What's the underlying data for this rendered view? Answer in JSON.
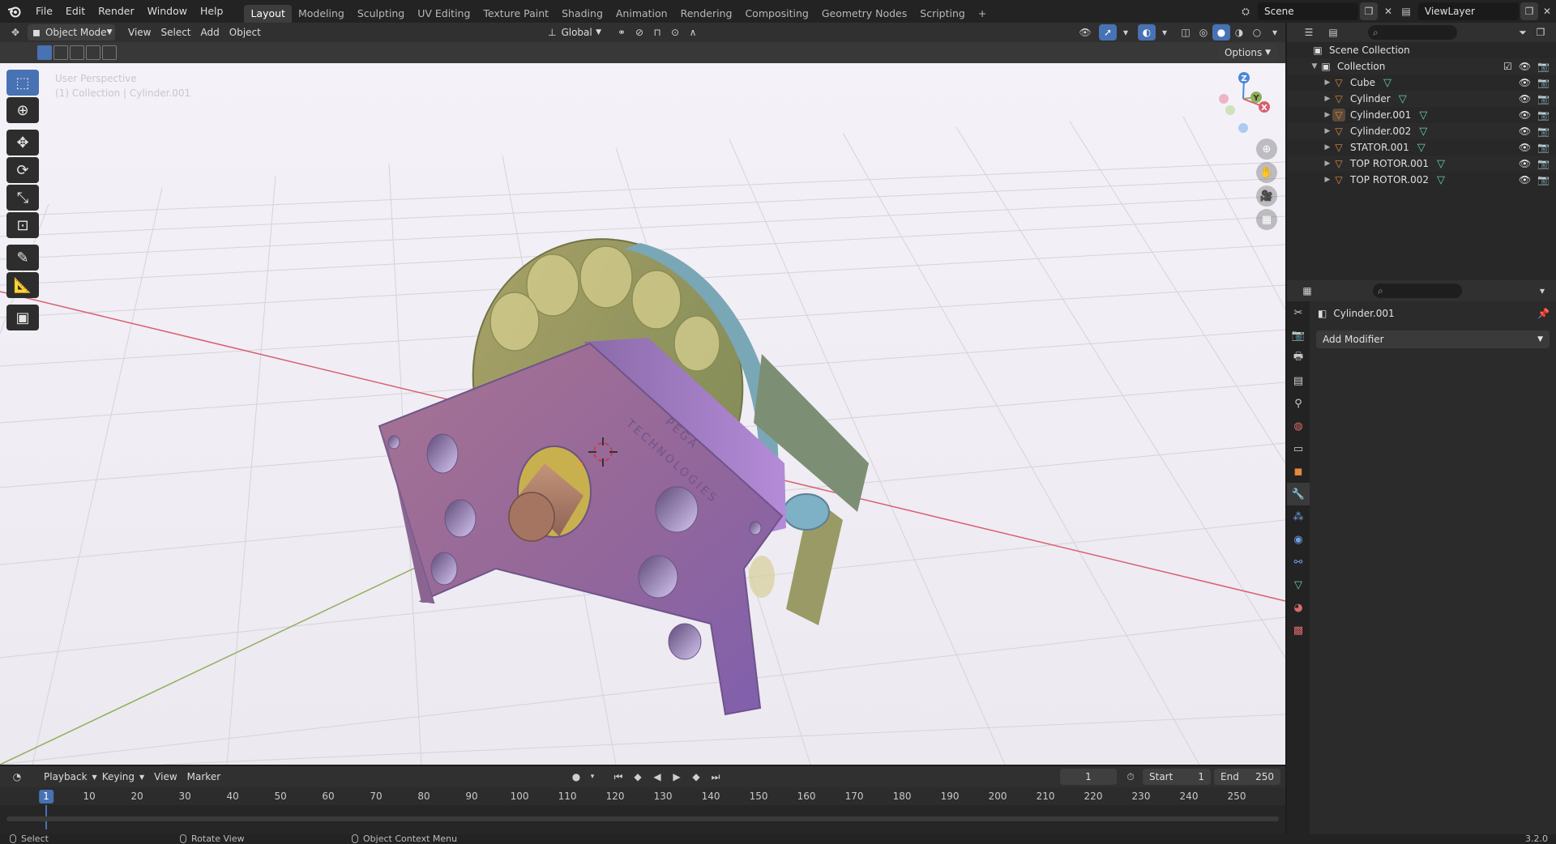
{
  "menus": [
    "File",
    "Edit",
    "Render",
    "Window",
    "Help"
  ],
  "workspaces": [
    "Layout",
    "Modeling",
    "Sculpting",
    "UV Editing",
    "Texture Paint",
    "Shading",
    "Animation",
    "Rendering",
    "Compositing",
    "Geometry Nodes",
    "Scripting"
  ],
  "add_workspace": "+",
  "scene": "Scene",
  "view_layer": "ViewLayer",
  "viewport_header": {
    "mode": "Object Mode",
    "menus": [
      "View",
      "Select",
      "Add",
      "Object"
    ],
    "transform_orientation": "Global",
    "options_label": "Options"
  },
  "viewport_overlay": {
    "perspective": "User Perspective",
    "context": "(1) Collection | Cylinder.001"
  },
  "gizmo": {
    "z": "Z",
    "y": "Y",
    "x": "X"
  },
  "outliner": {
    "scene_collection": "Scene Collection",
    "collection": "Collection",
    "objects": [
      "Cube",
      "Cylinder",
      "Cylinder.001",
      "Cylinder.002",
      "STATOR.001",
      "TOP ROTOR.001",
      "TOP ROTOR.002"
    ]
  },
  "properties": {
    "object_name": "Cylinder.001",
    "add_modifier": "Add Modifier"
  },
  "timeline": {
    "menus": [
      "Playback",
      "Keying",
      "View",
      "Marker"
    ],
    "current_frame": "1",
    "start_label": "Start",
    "start": "1",
    "end_label": "End",
    "end": "250",
    "ticks": [
      "1",
      "10",
      "20",
      "30",
      "40",
      "50",
      "60",
      "70",
      "80",
      "90",
      "100",
      "110",
      "120",
      "130",
      "140",
      "150",
      "160",
      "170",
      "180",
      "190",
      "200",
      "210",
      "220",
      "230",
      "240",
      "250"
    ]
  },
  "statusbar": {
    "select": "Select",
    "rotate": "Rotate View",
    "context_menu": "Object Context Menu",
    "version": "3.2.0"
  },
  "model_engraving": [
    "PEGA",
    "TECHNOLOGIES"
  ],
  "colors": {
    "accent": "#4772b3",
    "object_orange": "#e58a3b",
    "mesh_green": "#6ad39c",
    "axis_red": "#d8606f",
    "axis_green": "#8fb05a"
  }
}
